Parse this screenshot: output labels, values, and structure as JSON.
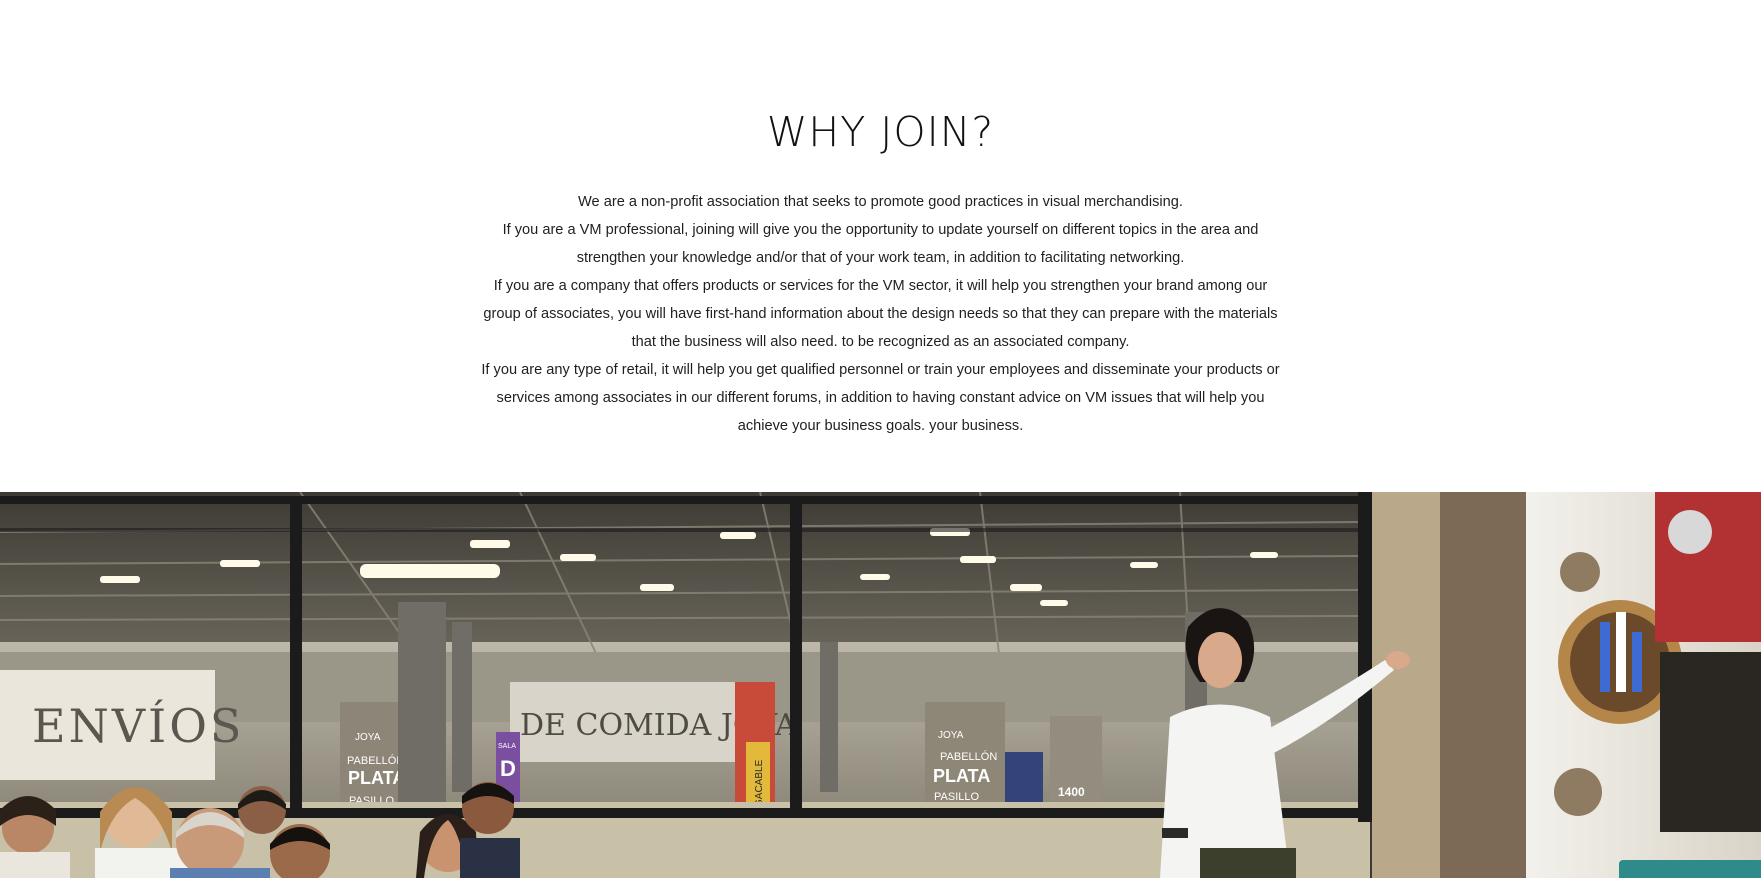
{
  "why_join": {
    "title": "WHY JOIN?",
    "paragraphs": [
      "We are a non-profit association that seeks to promote good practices in visual merchandising.",
      "If you are a VM professional, joining will give you the opportunity to update yourself on different topics in the area and strengthen your knowledge and/or that of your work team, in addition to facilitating networking.",
      "If you are a company that offers products or services for the VM sector, it will help you strengthen your brand among our group of associates, you will have first-hand information about the design needs so that they can prepare with the materials that the business will also need. to be recognized as an associated company.",
      "If you are any type of retail, it will help you get qualified personnel or train your employees and disseminate your products or services among associates in our different forums, in addition to having constant advice on VM issues that will help you achieve your business goals. your business."
    ]
  },
  "photo": {
    "signs": {
      "envios": "ENVÍOS",
      "comida": "DE COMIDA JOYA",
      "joya": "JOYA",
      "pabellon": "PABELLÓN",
      "plata": "PLATA",
      "pasillo": "PASILLO",
      "aisle_number": "1400",
      "sala": "SALA",
      "sala_letter": "D",
      "megacable": "MEGACABLE"
    },
    "colors": {
      "ceiling": "#55524a",
      "wall": "#c9c0a8",
      "frame": "#1b1b1b",
      "screen": "#ece9e2",
      "chat_widget": "#2f8a8a"
    }
  }
}
